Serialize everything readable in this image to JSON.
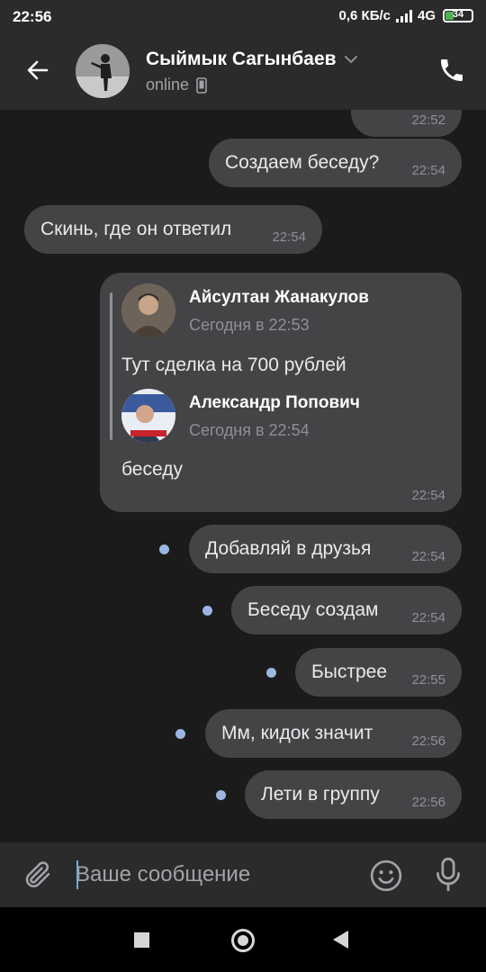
{
  "status_bar": {
    "time": "22:56",
    "network_speed": "0,6 КБ/с",
    "network_type": "4G",
    "battery_level": "34"
  },
  "header": {
    "contact_name": "Сыймык Сагынбаев",
    "status": "online",
    "back_icon": "arrow-left-icon",
    "phone_icon": "phone-icon"
  },
  "messages": [
    {
      "text": "",
      "time": "22:52",
      "outgoing": true,
      "partial": true
    },
    {
      "text": "Создаем беседу?",
      "time": "22:54",
      "outgoing": true
    },
    {
      "text": "Скинь, где он ответил",
      "time": "22:54",
      "outgoing": false
    },
    {
      "forwarded": [
        {
          "name": "Айсултан Жанакулов",
          "date": "Сегодня в 22:53",
          "text": "Тут сделка на 700 рублей"
        },
        {
          "name": "Александр Попович",
          "date": "Сегодня в 22:54",
          "text": "беседу"
        }
      ],
      "time": "22:54",
      "outgoing": true
    },
    {
      "text": "Добавляй в друзья",
      "time": "22:54",
      "outgoing": true,
      "unread": true
    },
    {
      "text": "Беседу создам",
      "time": "22:54",
      "outgoing": true,
      "unread": true
    },
    {
      "text": "Быстрее",
      "time": "22:55",
      "outgoing": true,
      "unread": true
    },
    {
      "text": "Мм, кидок значит",
      "time": "22:56",
      "outgoing": true,
      "unread": true
    },
    {
      "text": "Лети в группу",
      "time": "22:56",
      "outgoing": true,
      "unread": true
    }
  ],
  "composer": {
    "placeholder": "Ваше сообщение",
    "attach_icon": "paperclip-icon",
    "emoji_icon": "smiley-icon",
    "mic_icon": "microphone-icon"
  },
  "colors": {
    "background": "#1b1b1c",
    "bar": "#2b2b2c",
    "bubble": "#444446",
    "unread_dot": "#9cb6e2",
    "accent": "#71aaeb"
  }
}
